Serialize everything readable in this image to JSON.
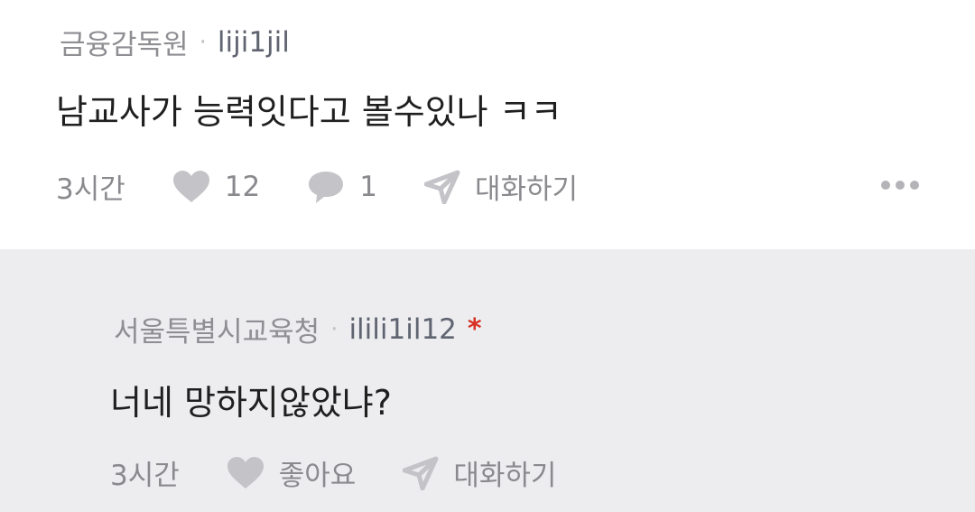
{
  "comment": {
    "org": "금융감독원",
    "separator": "·",
    "nickname": "liji1jil",
    "text": "남교사가 능력잇다고 볼수있나 ㅋㅋ",
    "time": "3시간",
    "like_count": "12",
    "reply_count": "1",
    "chat_label": "대화하기",
    "icons": [
      "heart-icon",
      "comment-bubble-icon",
      "send-icon",
      "more-dots-icon"
    ]
  },
  "reply": {
    "org": "서울특별시교육청",
    "separator": "·",
    "nickname": "ilili1il12",
    "author_marker": "*",
    "text": "너네 망하지않았냐?",
    "time": "3시간",
    "like_label": "좋아요",
    "chat_label": "대화하기",
    "icons": [
      "heart-icon",
      "send-icon"
    ]
  },
  "colors": {
    "reply_background": "#ededf0",
    "author_marker": "#d93025",
    "icon_gray": "#c4c4c8"
  }
}
